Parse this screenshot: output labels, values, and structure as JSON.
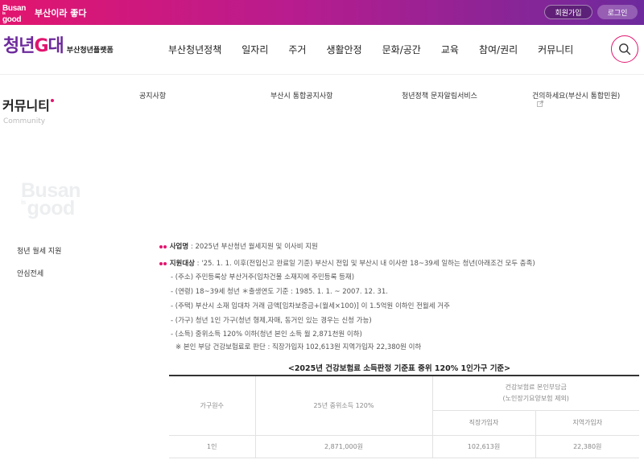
{
  "topbar": {
    "logo_main": "Busan",
    "logo_is": "is",
    "logo_good": "good",
    "slogan": "부산이라 좋다",
    "join_label": "회원가입",
    "login_label": "로그인"
  },
  "header": {
    "brand_part1": "청년",
    "brand_g": "G",
    "brand_part2": "대",
    "brand_sub": "부산청년플랫폼",
    "nav": [
      "부산청년정책",
      "일자리",
      "주거",
      "생활안정",
      "문화/공간",
      "교육",
      "참여/권리",
      "커뮤니티"
    ]
  },
  "community": {
    "title": "커뮤니티",
    "title_en": "Community",
    "menu": [
      "공지사항",
      "부산시 통합공지사항",
      "청년정책 문자알림서비스",
      "건의하세요(부산시 통합민원)"
    ]
  },
  "watermark": {
    "line1": "Busan",
    "is": "is",
    "line2": "good"
  },
  "side_menu": [
    "청년 월세 지원",
    "안심전세"
  ],
  "content": {
    "project_label": "사업명",
    "project_text": " : 2025년 부산청년 월세지원 및 이사비 지원",
    "target_label": "지원대상",
    "target_text": " : '25. 1. 1. 이후(전입신고 완료일 기준) 부산시 전입 및 부산시 내 이사한 18~39세 일하는 청년(아래조건 모두 충족)",
    "conditions": [
      "- (주소) 주민등록상 부산거주(임차건물 소재지에 주민등록 등재)",
      "- (연령) 18~39세 청년 ＊출생연도 기준 : 1985. 1. 1. ~ 2007. 12. 31.",
      "- (주택) 부산시 소재 임대차 거래 금액[임차보증금+(월세×100)] 이 1.5억원 이하인 전월세 거주",
      "- (가구) 청년 1인 가구(청년 형제,자매, 동거인 있는 경우는 신청 가능)",
      "- (소득) 중위소득 120% 이하(청년 본인 소득 월 2,871천원 이하)"
    ],
    "sub_note": "※ 본인 부담 건강보험료로 판단 : 직장가입자 102,613원 지역가입자 22,380원 이하"
  },
  "table": {
    "caption": "<2025년 건강보험료 소득판정 기준표 중위 120% 1인가구 기준>",
    "header": {
      "household": "가구원수",
      "median": "25년 중위소득 120%",
      "insurance_line1": "건강보험료 본인부담금",
      "insurance_line2": "(노인장기요양보험 제외)",
      "employee": "직장가입자",
      "regional": "지역가입자"
    },
    "rows": [
      {
        "household": "1인",
        "median": "2,871,000원",
        "employee": "102,613원",
        "regional": "22,380원"
      }
    ]
  },
  "colors": {
    "brand_pink": "#e2156f",
    "brand_purple": "#6d2a9c"
  },
  "icons": [
    "search-icon",
    "external-link-icon"
  ]
}
